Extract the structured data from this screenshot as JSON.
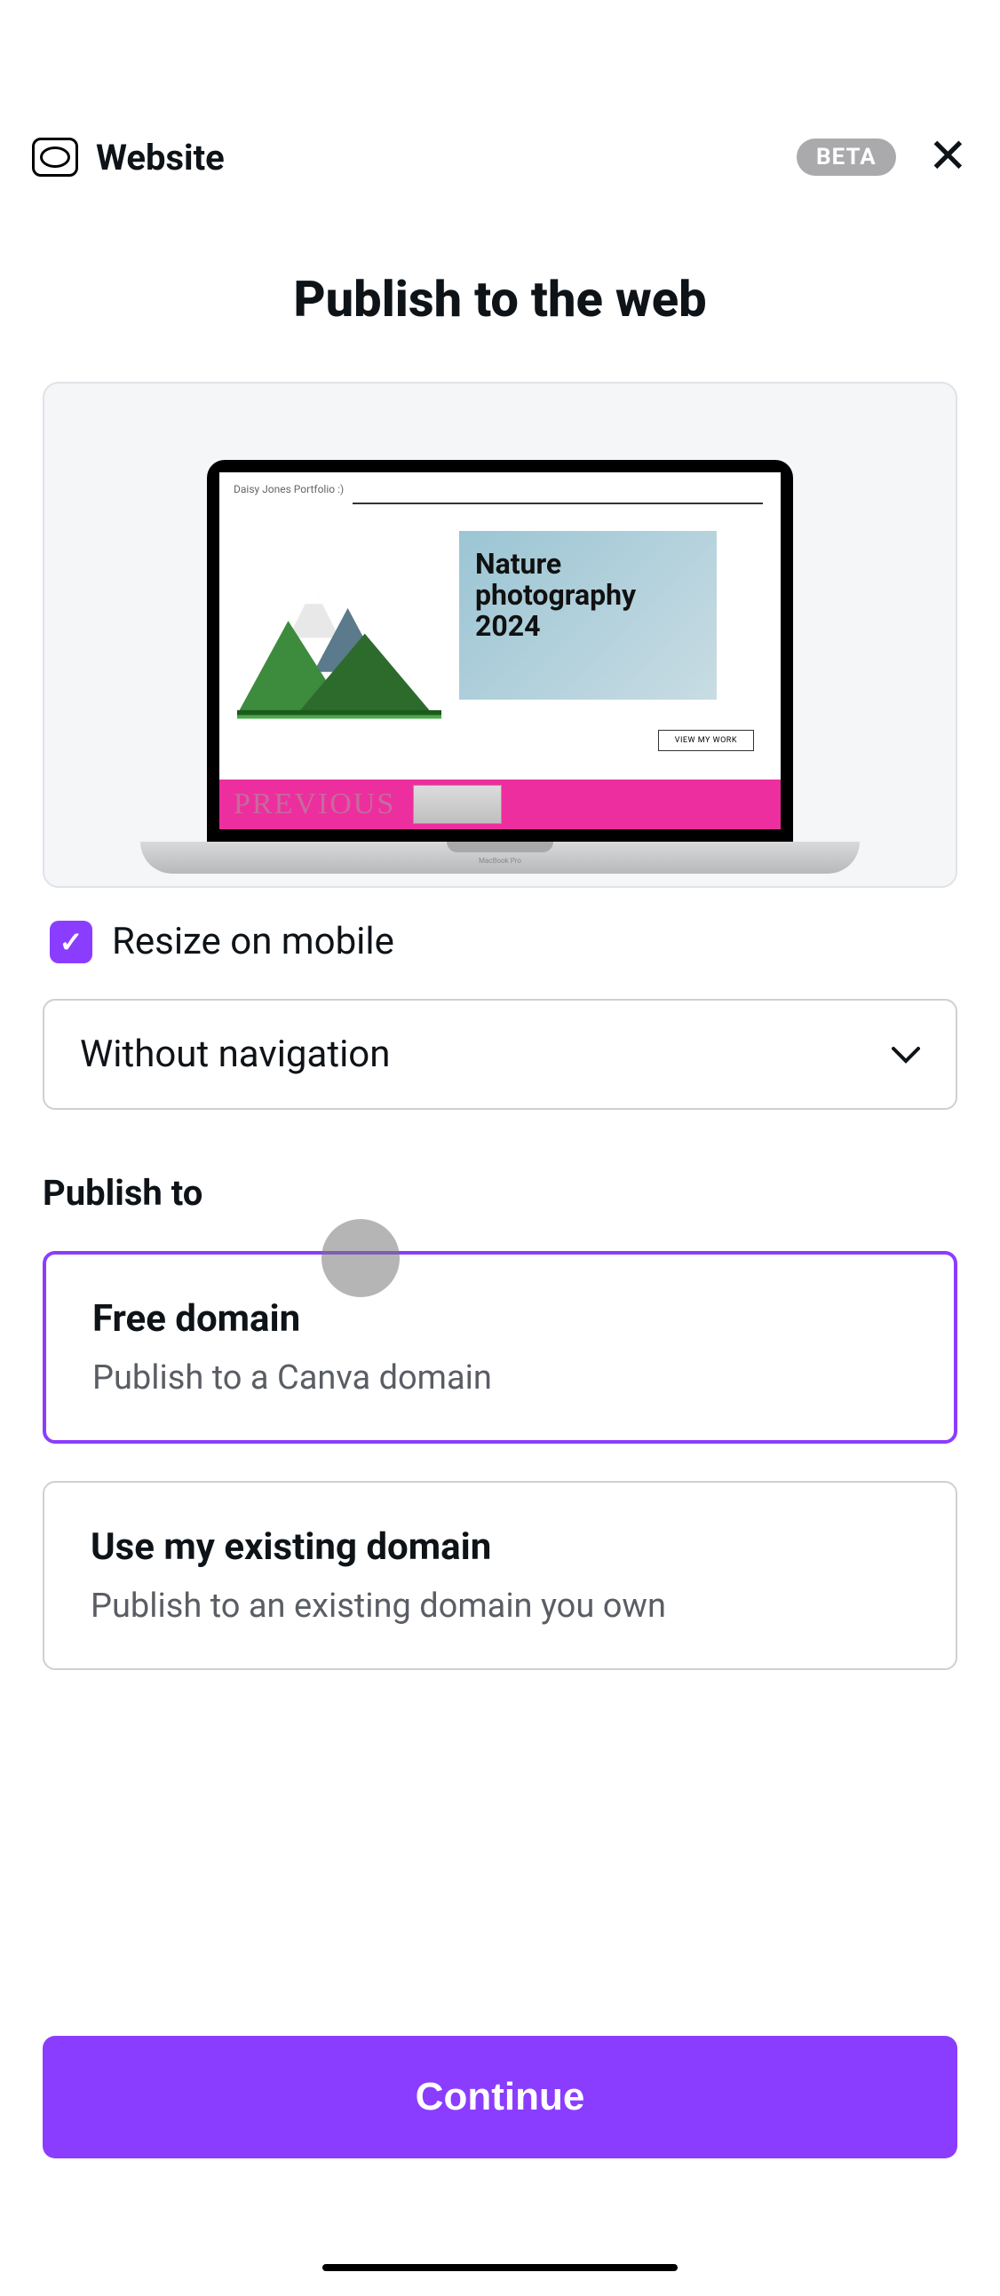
{
  "header": {
    "title": "Website",
    "badge": "BETA"
  },
  "main": {
    "title": "Publish to the web"
  },
  "preview": {
    "site_header": "Daisy Jones Portfolio :)",
    "photo_title_1": "Nature",
    "photo_title_2": "photography",
    "photo_title_3": "2024",
    "view_work": "VIEW MY WORK",
    "previous": "PREVIOUS",
    "brand": "MacBook Pro"
  },
  "options": {
    "resize_label": "Resize on mobile",
    "resize_checked": true,
    "navigation_label": "Without navigation"
  },
  "publish": {
    "section_label": "Publish to",
    "free_title": "Free domain",
    "free_sub": "Publish to a Canva domain",
    "existing_title": "Use my existing domain",
    "existing_sub": "Publish to an existing domain you own"
  },
  "actions": {
    "continue": "Continue"
  }
}
